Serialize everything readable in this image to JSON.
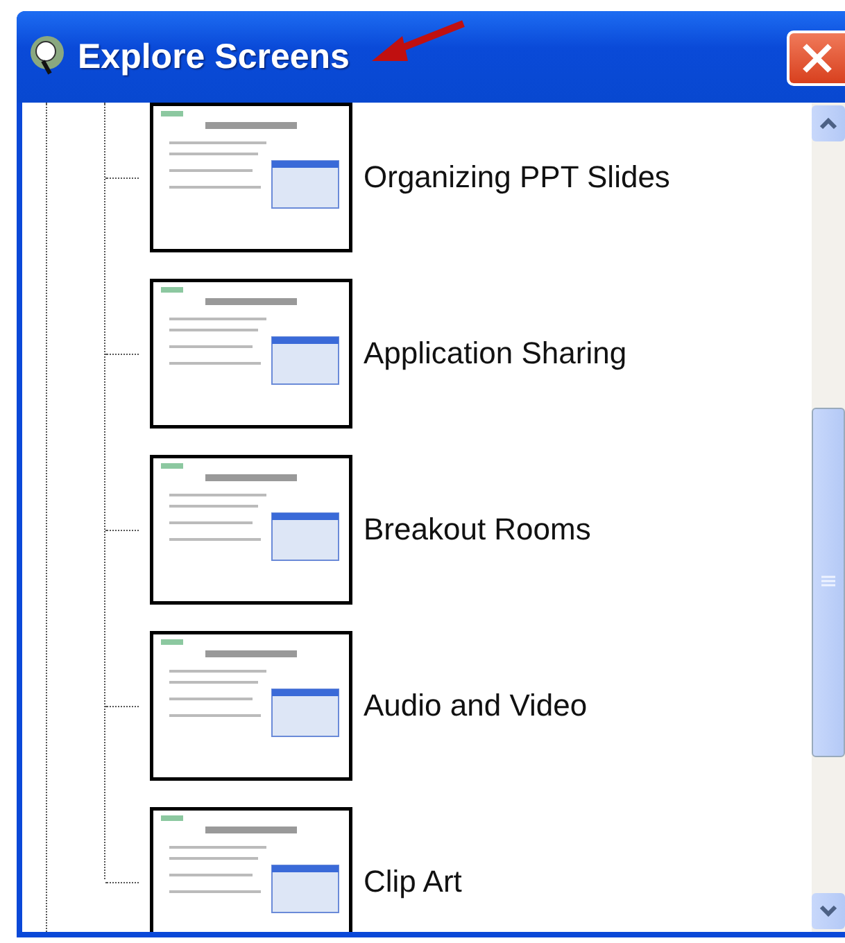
{
  "window": {
    "title": "Explore Screens"
  },
  "screens": [
    {
      "label": "Organizing PPT Slides"
    },
    {
      "label": "Application Sharing"
    },
    {
      "label": "Breakout Rooms"
    },
    {
      "label": "Audio and Video"
    },
    {
      "label": "Clip Art"
    }
  ]
}
